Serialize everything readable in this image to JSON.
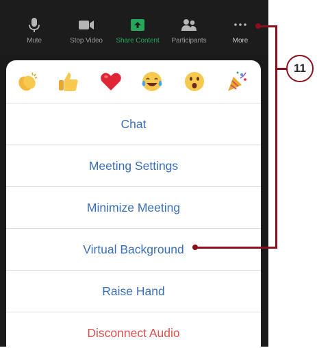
{
  "toolbar": {
    "mute": "Mute",
    "stop_video": "Stop Video",
    "share_content": "Share Content",
    "participants": "Participants",
    "more": "More"
  },
  "reactions": [
    "clapping-hands",
    "thumbs-up",
    "red-heart",
    "tears-of-joy",
    "open-mouth",
    "party-popper"
  ],
  "menu": {
    "chat": "Chat",
    "meeting_settings": "Meeting Settings",
    "minimize_meeting": "Minimize Meeting",
    "virtual_background": "Virtual Background",
    "raise_hand": "Raise Hand",
    "disconnect_audio": "Disconnect Audio"
  },
  "callout": {
    "number": "11"
  },
  "colors": {
    "menu_text": "#3a6fb7",
    "danger_text": "#d9534f",
    "share_green": "#26a65b",
    "annotation": "#8b0f1a"
  }
}
